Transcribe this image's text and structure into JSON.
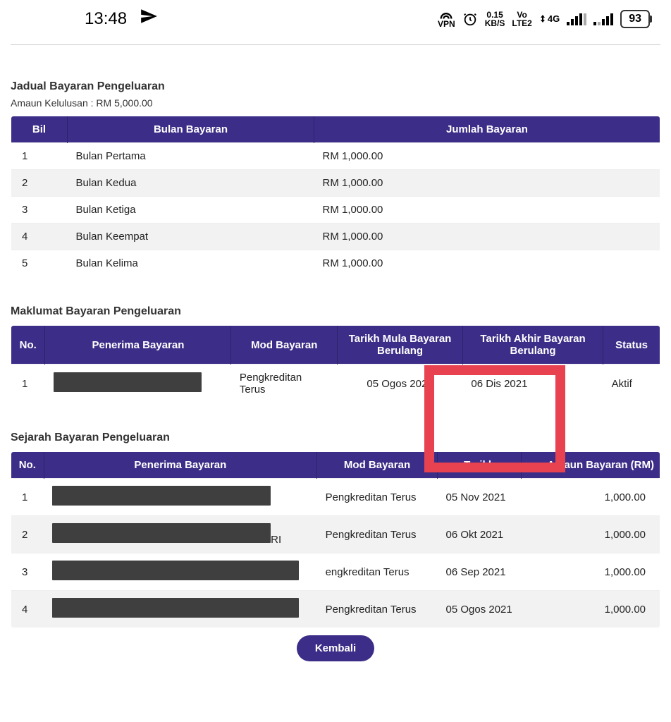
{
  "status": {
    "time": "13:48",
    "vpn": "VPN",
    "data_rate_top": "0.15",
    "data_rate_bottom": "KB/S",
    "volte_top": "Vo",
    "volte_bottom": "LTE2",
    "net_top": "4G",
    "battery": "93"
  },
  "section1": {
    "title": "Jadual Bayaran Pengeluaran",
    "approval_label": "Amaun Kelulusan : RM 5,000.00",
    "headers": {
      "bil": "Bil",
      "bulan": "Bulan Bayaran",
      "jumlah": "Jumlah Bayaran"
    },
    "rows": [
      {
        "bil": "1",
        "bulan": "Bulan Pertama",
        "jumlah": "RM 1,000.00"
      },
      {
        "bil": "2",
        "bulan": "Bulan Kedua",
        "jumlah": "RM 1,000.00"
      },
      {
        "bil": "3",
        "bulan": "Bulan Ketiga",
        "jumlah": "RM 1,000.00"
      },
      {
        "bil": "4",
        "bulan": "Bulan Keempat",
        "jumlah": "RM 1,000.00"
      },
      {
        "bil": "5",
        "bulan": "Bulan Kelima",
        "jumlah": "RM 1,000.00"
      }
    ]
  },
  "section2": {
    "title": "Maklumat Bayaran Pengeluaran",
    "headers": {
      "no": "No.",
      "penerima": "Penerima Bayaran",
      "mod": "Mod Bayaran",
      "mula": "Tarikh Mula Bayaran Berulang",
      "akhir": "Tarikh Akhir Bayaran Berulang",
      "status": "Status"
    },
    "rows": [
      {
        "no": "1",
        "mod": "Pengkreditan Terus",
        "mula": "05 Ogos 2021",
        "akhir": "06 Dis 2021",
        "status": "Aktif"
      }
    ]
  },
  "section3": {
    "title": "Sejarah Bayaran Pengeluaran",
    "headers": {
      "no": "No.",
      "penerima": "Penerima Bayaran",
      "mod": "Mod Bayaran",
      "tarikh": "Tarikh",
      "amaun": "Amaun Bayaran (RM)"
    },
    "rows": [
      {
        "no": "1",
        "suffix": "",
        "mod": "Pengkreditan Terus",
        "tarikh": "05 Nov 2021",
        "amaun": "1,000.00"
      },
      {
        "no": "2",
        "suffix": "RI",
        "mod": "Pengkreditan Terus",
        "tarikh": "06 Okt 2021",
        "amaun": "1,000.00"
      },
      {
        "no": "3",
        "suffix": "",
        "mod": "engkreditan Terus",
        "tarikh": "06 Sep 2021",
        "amaun": "1,000.00"
      },
      {
        "no": "4",
        "suffix": "",
        "mod": "Pengkreditan Terus",
        "tarikh": "05 Ogos 2021",
        "amaun": "1,000.00"
      }
    ]
  },
  "buttons": {
    "back": "Kembali"
  }
}
